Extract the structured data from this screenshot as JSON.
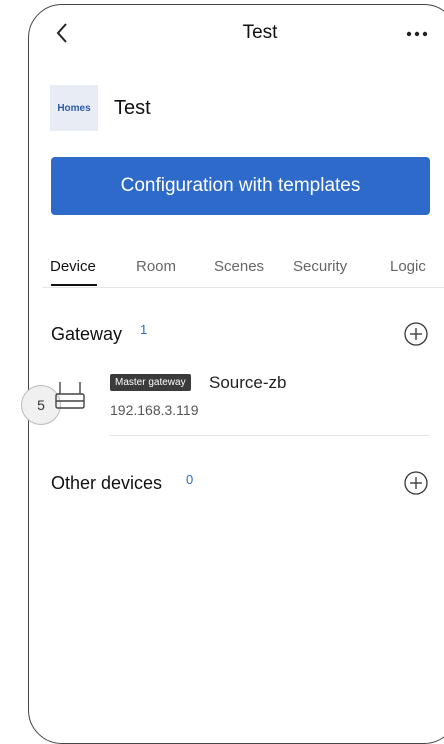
{
  "header": {
    "title": "Test",
    "back_icon": "chevron-left-icon",
    "more_icon": "more-horizontal-icon"
  },
  "home": {
    "logo_text": "Homes",
    "name": "Test"
  },
  "config_button": {
    "label": "Configuration with templates",
    "color": "#2d6ac9"
  },
  "tabs": [
    {
      "label": "Device",
      "active": true
    },
    {
      "label": "Room"
    },
    {
      "label": "Scenes"
    },
    {
      "label": "Security"
    },
    {
      "label": "Logic"
    }
  ],
  "gateway_section": {
    "title": "Gateway",
    "count": "1",
    "devices": [
      {
        "tag": "Master gateway",
        "name": "Source-zb",
        "ip": "192.168.3.119"
      }
    ]
  },
  "other_section": {
    "title": "Other devices",
    "count": "0"
  },
  "step_badge": "5"
}
